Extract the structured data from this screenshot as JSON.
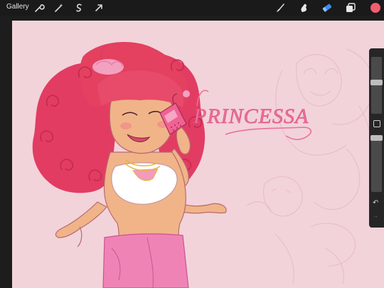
{
  "topbar": {
    "gallery_label": "Gallery",
    "left_tools": [
      "wrench-icon",
      "magic-wand-icon",
      "selection-icon",
      "transform-arrow-icon"
    ],
    "right_tools": [
      "brush-icon",
      "smudge-icon",
      "eraser-icon",
      "layers-icon"
    ],
    "active_tool": "eraser-icon",
    "current_color": "#f05d6e"
  },
  "canvas": {
    "background": "#f2d3da",
    "artwork_text": "PRINCESSA"
  },
  "sidebar": {
    "size_slider_level": 0.55,
    "opacity_slider_level": 0.05,
    "undo_icon": "undo-arrow-icon",
    "redo_icon": "redo-arrow-icon"
  }
}
